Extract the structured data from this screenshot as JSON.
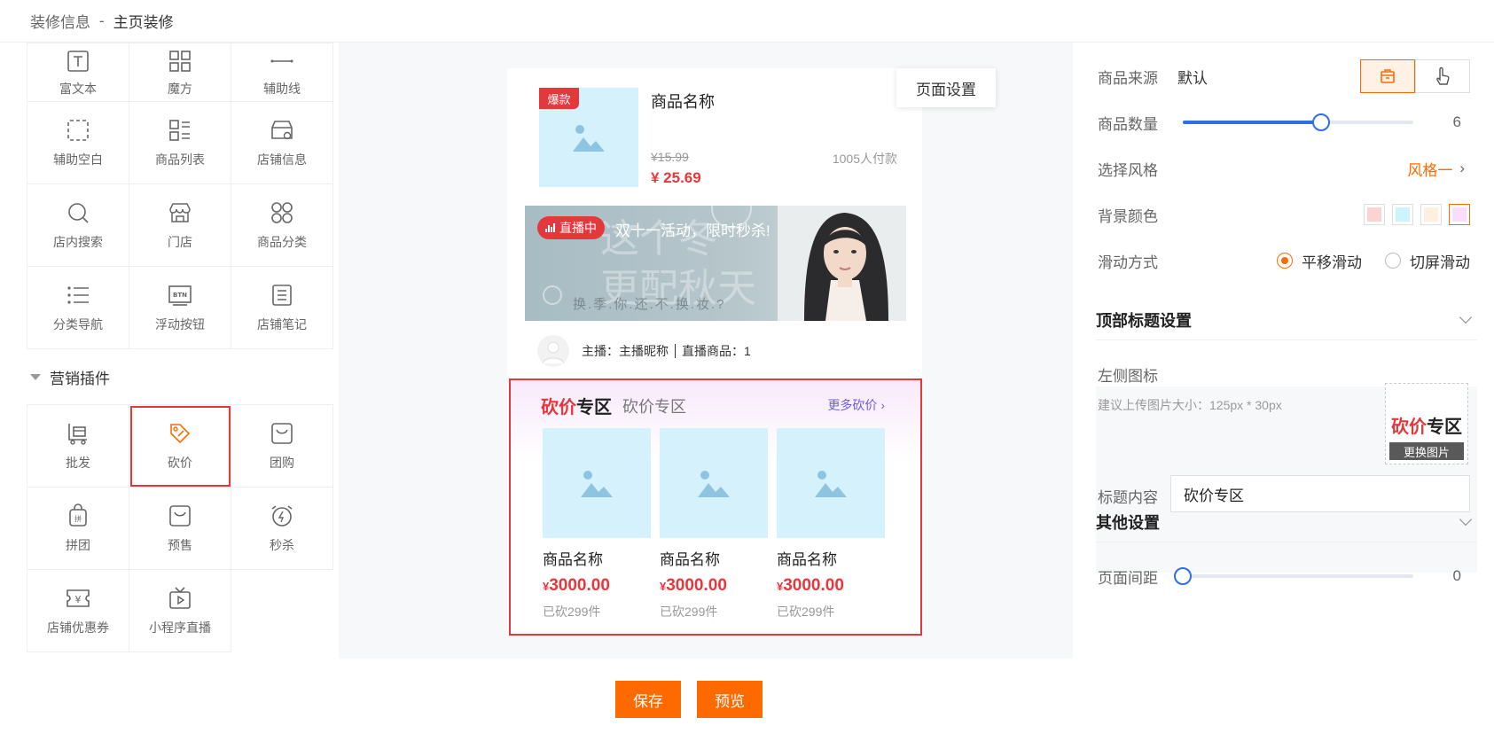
{
  "breadcrumb": {
    "parent": "装修信息",
    "separator": "-",
    "current": "主页装修"
  },
  "components": {
    "basic": [
      {
        "label": "富文本",
        "icon": "rich-text-icon"
      },
      {
        "label": "魔方",
        "icon": "magic-cube-icon"
      },
      {
        "label": "辅助线",
        "icon": "divider-line-icon"
      },
      {
        "label": "辅助空白",
        "icon": "blank-space-icon"
      },
      {
        "label": "商品列表",
        "icon": "product-list-icon"
      },
      {
        "label": "店铺信息",
        "icon": "shop-info-icon"
      },
      {
        "label": "店内搜索",
        "icon": "search-icon"
      },
      {
        "label": "门店",
        "icon": "store-icon"
      },
      {
        "label": "商品分类",
        "icon": "category-icon"
      },
      {
        "label": "分类导航",
        "icon": "list-nav-icon"
      },
      {
        "label": "浮动按钮",
        "icon": "float-button-icon"
      },
      {
        "label": "店铺笔记",
        "icon": "notes-icon"
      }
    ],
    "marketing_title": "营销插件",
    "marketing": [
      {
        "label": "批发",
        "icon": "wholesale-icon"
      },
      {
        "label": "砍价",
        "icon": "bargain-tag-icon"
      },
      {
        "label": "团购",
        "icon": "group-buy-icon"
      },
      {
        "label": "拼团",
        "icon": "pintuan-bag-icon"
      },
      {
        "label": "预售",
        "icon": "presale-icon"
      },
      {
        "label": "秒杀",
        "icon": "flash-sale-alarm-icon"
      },
      {
        "label": "店铺优惠券",
        "icon": "coupon-icon"
      },
      {
        "label": "小程序直播",
        "icon": "mini-live-tv-icon"
      }
    ]
  },
  "preview": {
    "page_setting_label": "页面设置",
    "product": {
      "tag": "爆款",
      "name": "商品名称",
      "old_price": "¥15.99",
      "paid": "1005人付款",
      "price": "¥ 25.69"
    },
    "live": {
      "badge": "直播中",
      "title": "双十一活动，限时秒杀!",
      "art_line1": "这个冬",
      "art_line2": "更配秋天",
      "art_sub": "换.季.你.还.不.换.妆.?"
    },
    "anchor": {
      "host": "主播：主播昵称",
      "goods": "直播商品：1"
    },
    "bargain": {
      "logo_a": "砍价",
      "logo_b": "专区",
      "title": "砍价专区",
      "more": "更多砍价",
      "items": [
        {
          "name": "商品名称",
          "currency": "¥",
          "price": "3000.00",
          "cut": "已砍299件"
        },
        {
          "name": "商品名称",
          "currency": "¥",
          "price": "3000.00",
          "cut": "已砍299件"
        },
        {
          "name": "商品名称",
          "currency": "¥",
          "price": "3000.00",
          "cut": "已砍299件"
        }
      ]
    }
  },
  "buttons": {
    "save": "保存",
    "preview": "预览"
  },
  "settings": {
    "source": {
      "label": "商品来源",
      "value": "默认"
    },
    "count": {
      "label": "商品数量",
      "value": "6",
      "fraction": 0.6
    },
    "style": {
      "label": "选择风格",
      "value": "风格一"
    },
    "bg_color": {
      "label": "背景颜色",
      "colors": [
        "#fcd3d3",
        "#cdf3fb",
        "#fdf0e0",
        "#fadcfb"
      ],
      "selected_index": 3
    },
    "scroll": {
      "label": "滑动方式",
      "options": [
        "平移滑动",
        "切屏滑动"
      ],
      "selected_index": 0
    },
    "top_title_section": "顶部标题设置",
    "left_icon": {
      "label": "左侧图标",
      "hint": "建议上传图片大小：125px * 30px",
      "logo_a": "砍价",
      "logo_b": "专区",
      "change": "更换图片"
    },
    "title_content": {
      "label": "标题内容",
      "value": "砍价专区"
    },
    "other_section": "其他设置",
    "page_margin": {
      "label": "页面间距",
      "value": "0",
      "fraction": 0
    }
  },
  "colors": {
    "accent": "#ff6a00",
    "danger": "#e4393c",
    "slider": "#2f6fe4"
  }
}
